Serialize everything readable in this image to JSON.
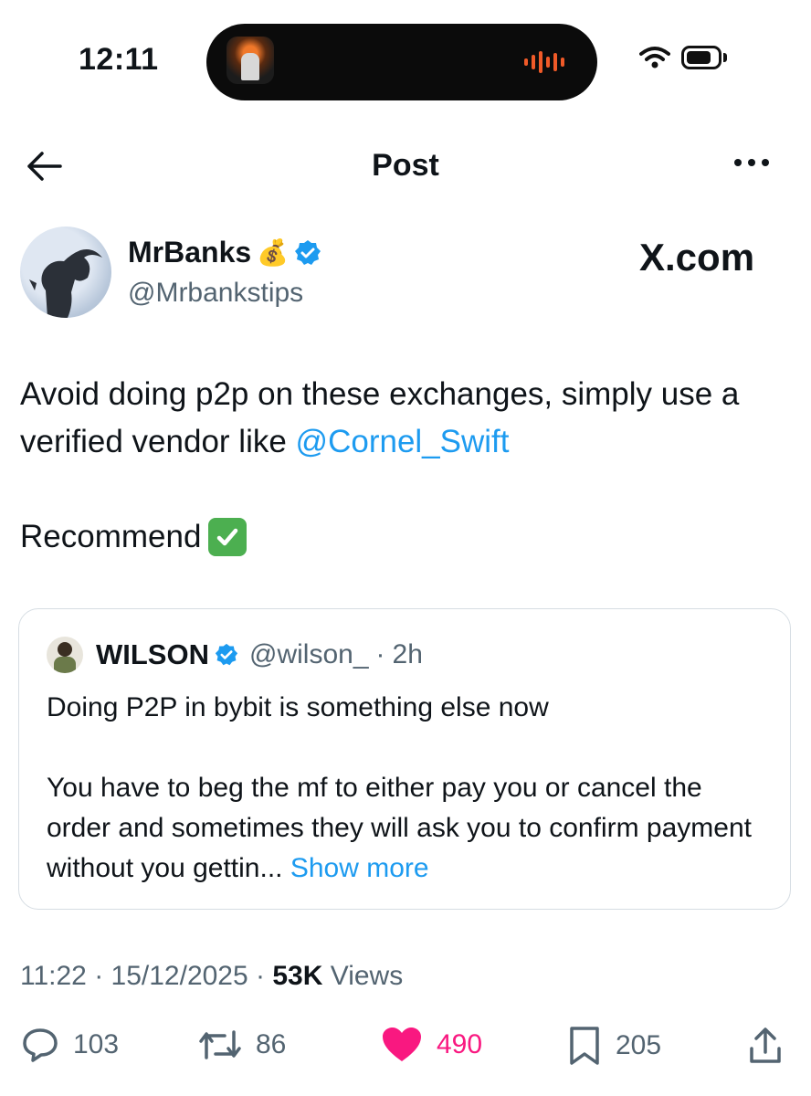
{
  "status_bar": {
    "time": "12:11"
  },
  "header": {
    "title": "Post"
  },
  "author": {
    "name": "MrBanks",
    "name_emoji": "💰",
    "handle": "@Mrbankstips",
    "watermark": "X.com"
  },
  "post": {
    "text_before": "Avoid doing p2p on these exchanges, simply use a verified vendor like ",
    "mention": "@Cornel_Swift",
    "recommend": "Recommend",
    "recommend_emoji": "✅"
  },
  "quoted": {
    "name": "WILSON",
    "handle": "@wilson_",
    "sep": "·",
    "time": "2h",
    "line1": "Doing P2P in bybit is something else now",
    "text": "You have to beg the mf to either pay you or cancel the order and sometimes they will ask you to confirm payment without you gettin... ",
    "show_more": "Show more"
  },
  "meta": {
    "time": "11:22",
    "sep1": " · ",
    "date": "15/12/2025",
    "sep2": " · ",
    "views_count": "53K",
    "views_label": " Views"
  },
  "actions": {
    "replies": "103",
    "reposts": "86",
    "likes": "490",
    "bookmarks": "205"
  },
  "colors": {
    "accent": "#1d9bf0",
    "like": "#f91880",
    "secondary": "#536471",
    "text": "#0f1419"
  }
}
